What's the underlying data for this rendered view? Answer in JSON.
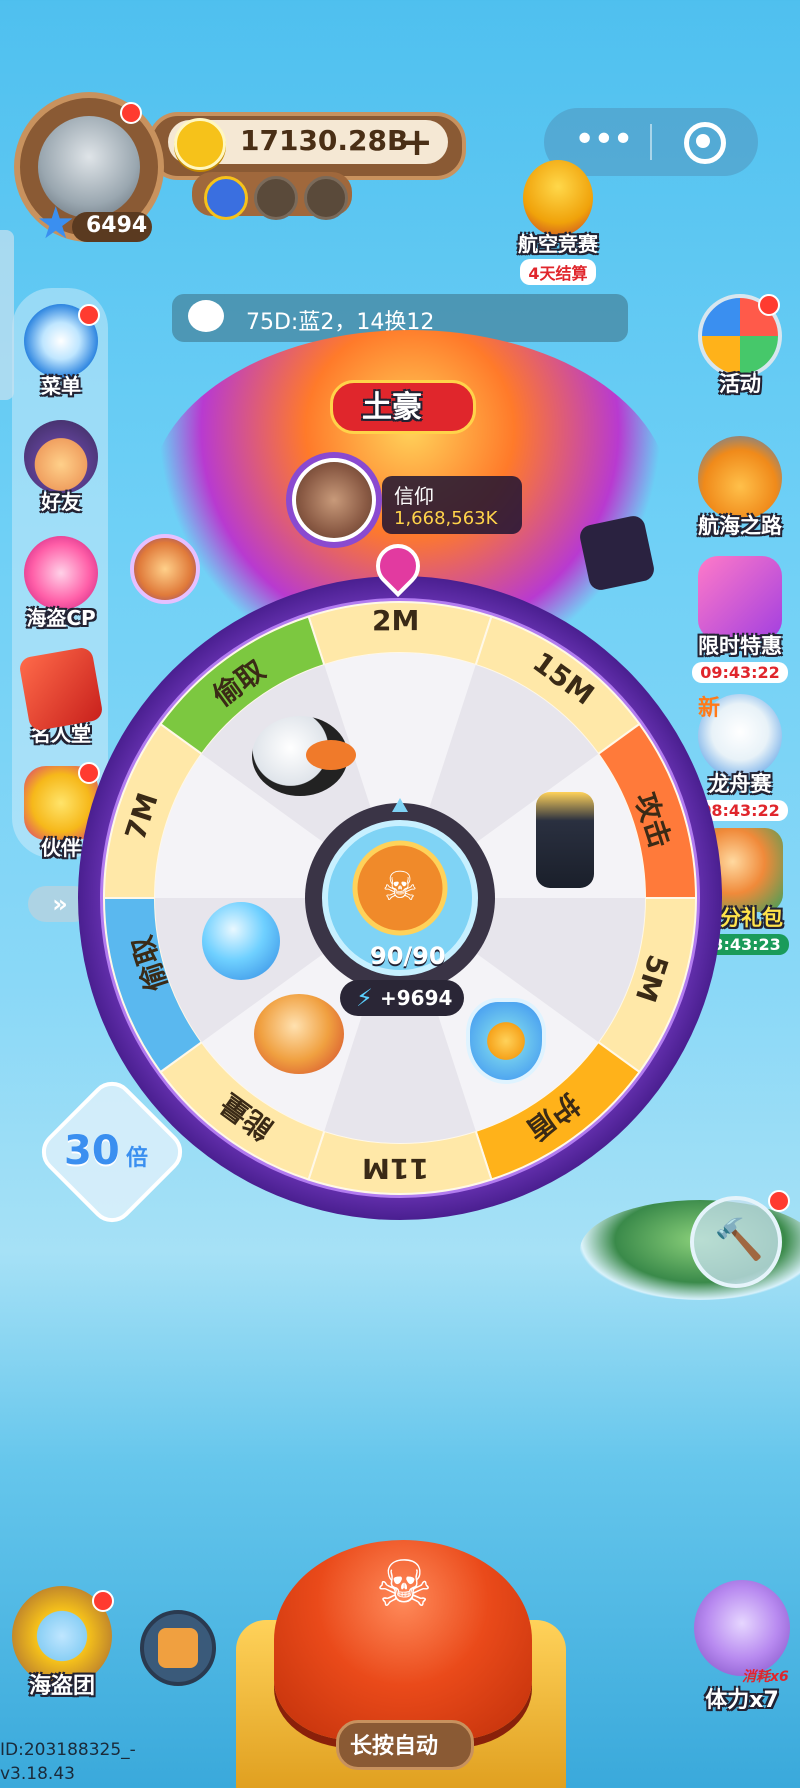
{
  "player": {
    "coins": "17130.28B",
    "stars": "6494",
    "id_line": "ID:203188325_-",
    "version": "v3.18.43"
  },
  "capsule": {
    "more_icon": "more-dots-icon",
    "target_icon": "target-icon"
  },
  "trophy": {
    "title": "航空竞赛",
    "sub": "4天结算"
  },
  "chat": {
    "message": "75D:蓝2，14换12"
  },
  "left_menu": [
    {
      "label": "菜单",
      "icon": "compass-icon"
    },
    {
      "label": "好友",
      "icon": "friends-icon"
    },
    {
      "label": "海盗CP",
      "icon": "heart-icon"
    },
    {
      "label": "名人堂",
      "icon": "scroll-icon"
    },
    {
      "label": "伙伴",
      "icon": "bunny-icon"
    }
  ],
  "right_menu": [
    {
      "label": "活动",
      "timer": ""
    },
    {
      "label": "航海之路",
      "timer": ""
    },
    {
      "label": "限时特惠",
      "timer": "09:43:22"
    },
    {
      "label": "龙舟赛",
      "timer": "08:43:22",
      "badge": "新"
    },
    {
      "label": "春分礼包",
      "timer": "33:43:23"
    }
  ],
  "boss": {
    "title": "土豪",
    "name": "信仰",
    "score": "1,668,563K"
  },
  "wheel": {
    "segments": [
      "2M",
      "15M",
      "攻击",
      "5M",
      "护盾",
      "11M",
      "能量",
      "偷取",
      "7M",
      "偷取"
    ],
    "display_segments": [
      "2M",
      "15M",
      "攻击",
      "5M",
      "护盾",
      "11M",
      "能量",
      "偷取",
      "7M"
    ],
    "energy": "90/90",
    "energy_plus": "+9694"
  },
  "multiplier": {
    "value": "30",
    "unit": "倍"
  },
  "bottom": {
    "pirate_team": "海盗团",
    "auto_label": "长按自动",
    "stamina": "体力x7",
    "cost": "消耗x6"
  },
  "colors": {
    "accent_red": "#e0262c",
    "wheel_purple": "#7b3fc8",
    "coin_gold": "#f6c21a"
  }
}
